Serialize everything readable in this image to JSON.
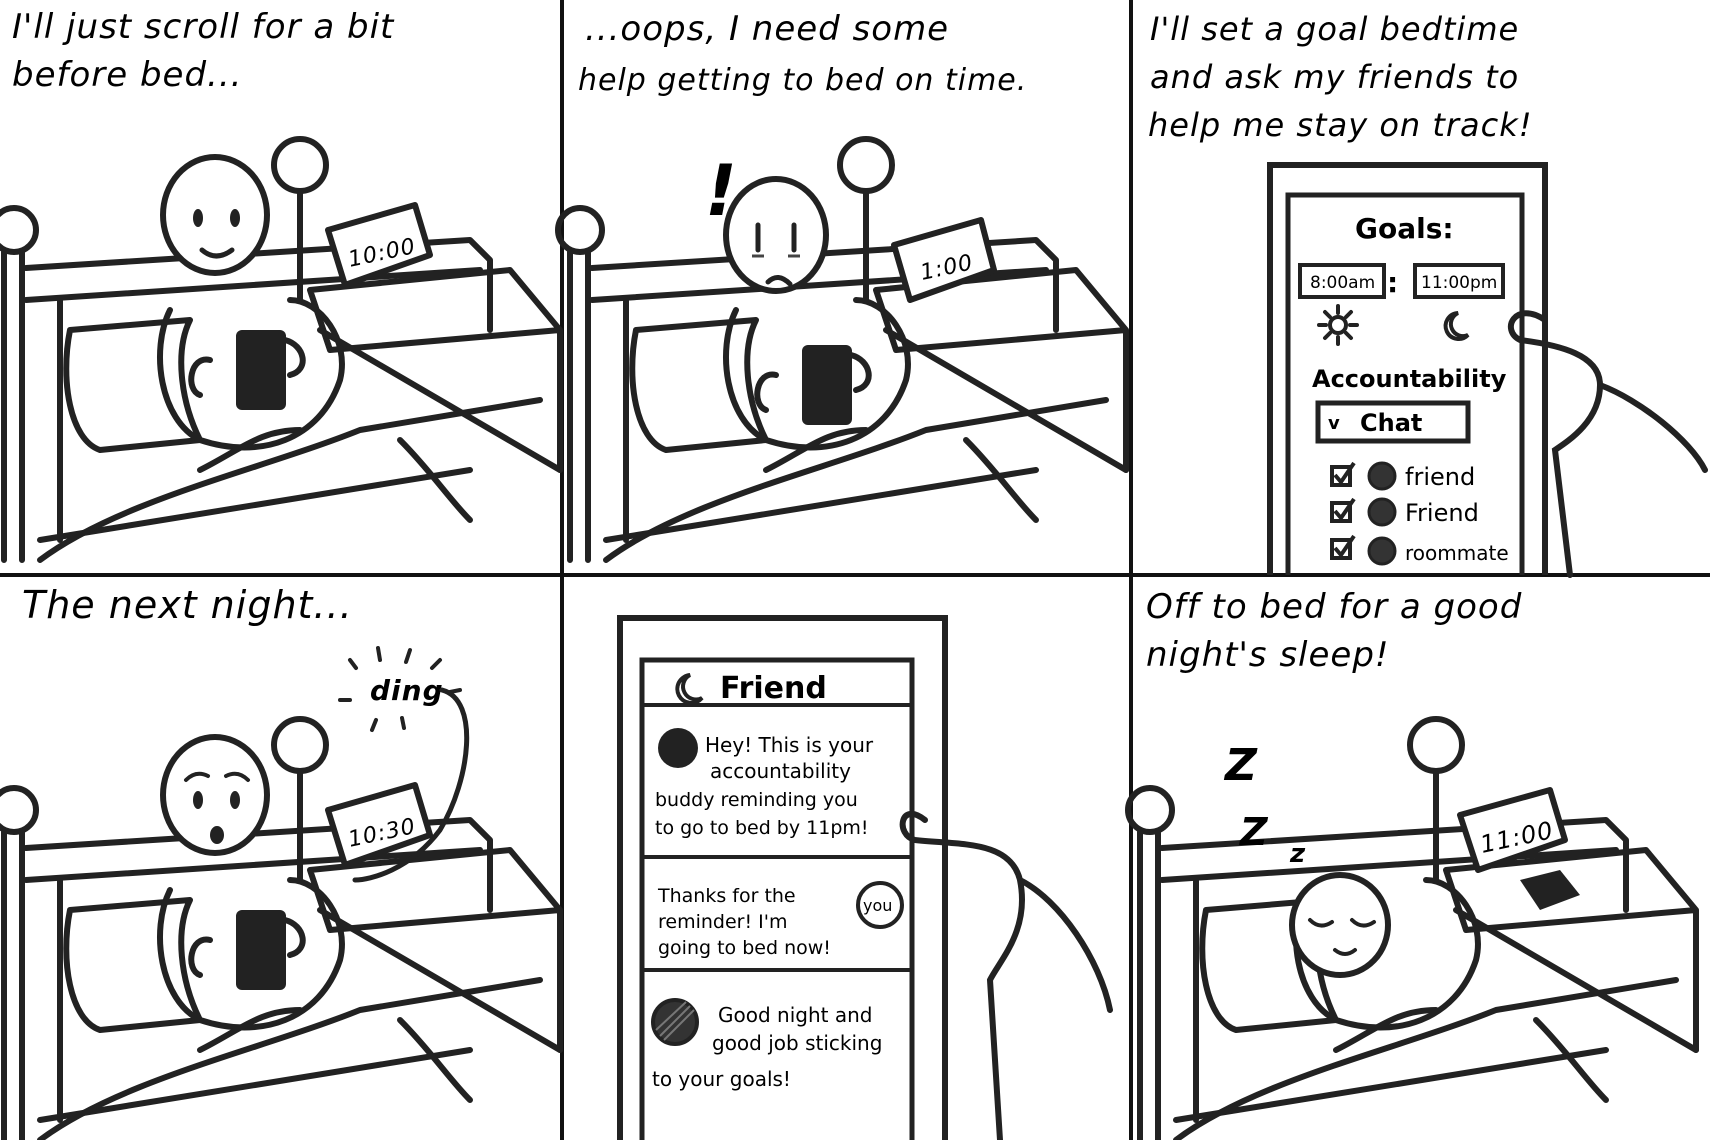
{
  "panels": [
    {
      "caption": [
        "I'll just scroll for a bit",
        "before bed..."
      ],
      "clock": "10:00"
    },
    {
      "caption": [
        "...oops, I need some",
        "help getting to bed on time."
      ],
      "exclaim": "!",
      "clock": "1:00"
    },
    {
      "caption": [
        "I'll set a goal bedtime",
        "and ask my friends to",
        "help me stay on track!"
      ],
      "phone": {
        "title": "Goals:",
        "wake_time": "8:00am",
        "colon": ":",
        "bed_time": "11:00pm",
        "section": "Accountability",
        "dropdown_arrow": "v",
        "dropdown_label": "Chat",
        "friends": [
          "friend",
          "Friend",
          "roommate"
        ]
      }
    },
    {
      "caption": [
        "The next night..."
      ],
      "sound": "ding",
      "clock": "10:30"
    },
    {
      "phone": {
        "chat_title": "Friend",
        "messages": [
          {
            "lines": [
              "Hey! This is your",
              "accountability",
              "buddy reminding you",
              "to go to bed by 11pm!"
            ]
          },
          {
            "lines": [
              "Thanks for the",
              "reminder! I'm",
              "going to bed now!"
            ],
            "avatar_label": "you"
          },
          {
            "lines": [
              "Good night and",
              "good job sticking",
              "to your goals!"
            ]
          }
        ]
      }
    },
    {
      "caption": [
        "Off to bed for a good",
        "night's sleep!"
      ],
      "snore": [
        "Z",
        "Z",
        "z"
      ],
      "clock": "11:00"
    }
  ]
}
